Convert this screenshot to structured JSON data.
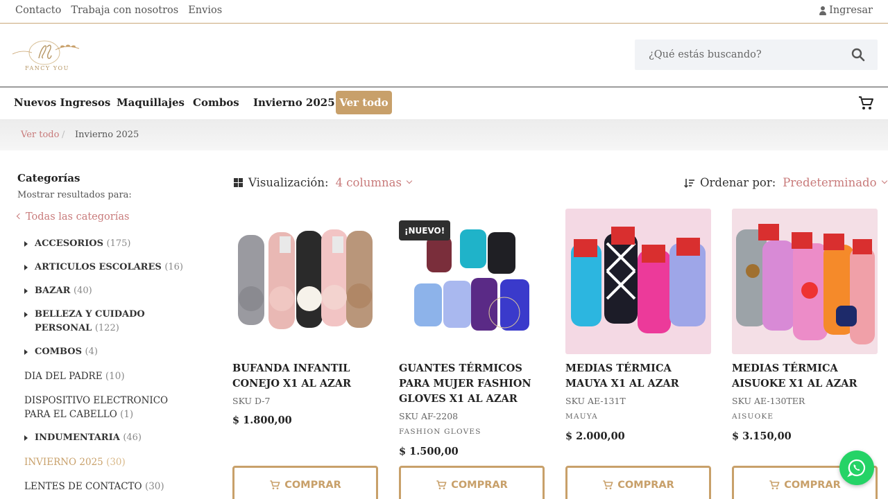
{
  "topbar": {
    "links": [
      "Contacto",
      "Trabaja con nosotros",
      "Envios"
    ],
    "login": "Ingresar"
  },
  "header": {
    "brand": "FANCY YOU",
    "search_placeholder": "¿Qué estás buscando?"
  },
  "nav": {
    "items": [
      "Nuevos Ingresos",
      "Maquillajes",
      "Combos",
      "Invierno 2025"
    ],
    "see_all": "Ver todo"
  },
  "breadcrumb": {
    "home": "Ver todo",
    "separator": "/",
    "current": "Invierno 2025"
  },
  "sidebar": {
    "title": "Categorías",
    "subtitle": "Mostrar resultados para:",
    "all": "Todas las categorías",
    "categories": [
      {
        "name": "ACCESORIOS",
        "count": "(175)"
      },
      {
        "name": "ARTICULOS ESCOLARES",
        "count": "(16)"
      },
      {
        "name": "BAZAR",
        "count": "(40)"
      },
      {
        "name": "BELLEZA Y CUIDADO PERSONAL",
        "count": "(122)"
      },
      {
        "name": "COMBOS",
        "count": "(4)"
      },
      {
        "name": "DIA DEL PADRE",
        "count": "(10)"
      },
      {
        "name": "DISPOSITIVO ELECTRONICO PARA EL CABELLO",
        "count": "(1)"
      },
      {
        "name": "INDUMENTARIA",
        "count": "(46)"
      },
      {
        "name": "INVIERNO 2025",
        "count": "(30)"
      },
      {
        "name": "LENTES DE CONTACTO",
        "count": "(30)"
      }
    ]
  },
  "toolbar": {
    "view_label": "Visualización:",
    "view_value": "4 columnas",
    "sort_label": "Ordenar por:",
    "sort_value": "Predeterminado"
  },
  "products": [
    {
      "name": "BUFANDA INFANTIL CONEJO X1 AL AZAR",
      "sku": "SKU D-7",
      "brand": "",
      "price": "$  1.800,00",
      "badge": ""
    },
    {
      "name": "GUANTES TÉRMICOS PARA MUJER FASHION GLOVES X1 AL AZAR",
      "sku": "SKU AF-2208",
      "brand": "FASHION GLOVES",
      "price": "$  1.500,00",
      "badge": "¡NUEVO!"
    },
    {
      "name": "MEDIAS TÉRMICA MAUYA X1 AL AZAR",
      "sku": "SKU AE-131T",
      "brand": "MAUYA",
      "price": "$  2.000,00",
      "badge": ""
    },
    {
      "name": "MEDIAS TÉRMICA AISUOKE X1 AL AZAR",
      "sku": "SKU AE-130TER",
      "brand": "AISUOKE",
      "price": "$  3.150,00",
      "badge": ""
    }
  ],
  "buy_label": "COMPRAR",
  "colors": {
    "accent": "#c8a06a",
    "link": "#c87a7a",
    "whatsapp": "#25d366",
    "badge": "#2f2f2f"
  }
}
